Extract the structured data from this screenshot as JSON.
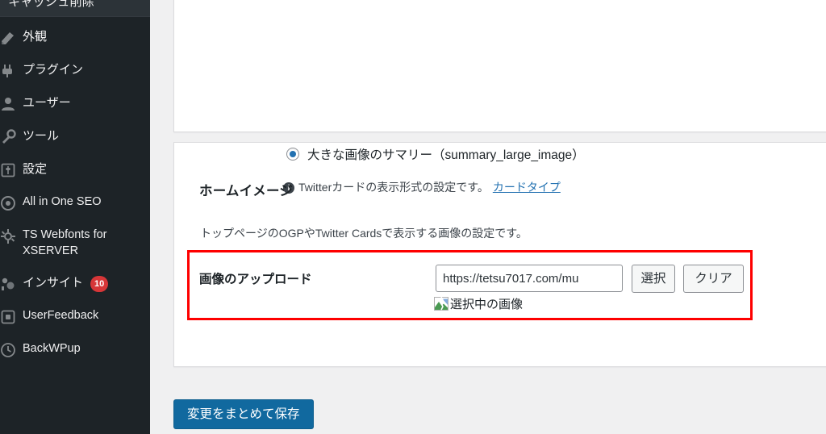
{
  "sidebar": {
    "clipped_top_item": "キャッシュ削除",
    "items": [
      {
        "label": "外観",
        "icon": "appearance-brush-icon",
        "badge": null,
        "latin": false
      },
      {
        "label": "プラグイン",
        "icon": "plugins-plug-icon",
        "badge": null,
        "latin": false
      },
      {
        "label": "ユーザー",
        "icon": "users-person-icon",
        "badge": null,
        "latin": false
      },
      {
        "label": "ツール",
        "icon": "tools-hammer-icon",
        "badge": null,
        "latin": false
      },
      {
        "label": "設定",
        "icon": "settings-sliders-icon",
        "badge": null,
        "latin": false
      },
      {
        "label": "All in One SEO",
        "icon": "aioseo-circle-icon",
        "badge": null,
        "latin": true
      },
      {
        "label": "TS Webfonts for XSERVER",
        "icon": "gear-icon",
        "badge": null,
        "latin": true
      },
      {
        "label": "インサイト",
        "icon": "insights-chart-icon",
        "badge": "10",
        "latin": false
      },
      {
        "label": "UserFeedback",
        "icon": "feedback-square-icon",
        "badge": null,
        "latin": true
      },
      {
        "label": "BackWPup",
        "icon": "backup-clock-icon",
        "badge": null,
        "latin": true
      }
    ]
  },
  "twitter_card_section": {
    "radio_option_label": "大きな画像のサマリー（summary_large_image）",
    "radio_selected": true,
    "hint_icon": "info-icon",
    "hint_text": "Twitterカードの表示形式の設定です。",
    "hint_link_label": "カードタイプ"
  },
  "home_image_section": {
    "title": "ホームイメージ",
    "description": "トップページのOGPやTwitter Cardsで表示する画像の設定です。",
    "upload_row": {
      "label": "画像のアップロード",
      "input_value": "https://tetsu7017.com/mu",
      "input_placeholder": "",
      "select_button": "選択",
      "clear_button": "クリア",
      "thumbnail_icon": "broken-image-icon",
      "thumbnail_alt_text": "選択中の画像"
    }
  },
  "footer": {
    "save_button": "変更をまとめて保存"
  },
  "colors": {
    "sidebar_bg": "#1d2327",
    "sidebar_highlight": "#2c3338",
    "page_bg": "#f0f0f1",
    "card_bg": "#ffffff",
    "card_border": "#dcdcde",
    "accent_blue": "#2271b1",
    "primary_button": "#11699f",
    "badge_red": "#d63638",
    "highlight_red": "#fe0000",
    "text_dark": "#1d2327"
  }
}
